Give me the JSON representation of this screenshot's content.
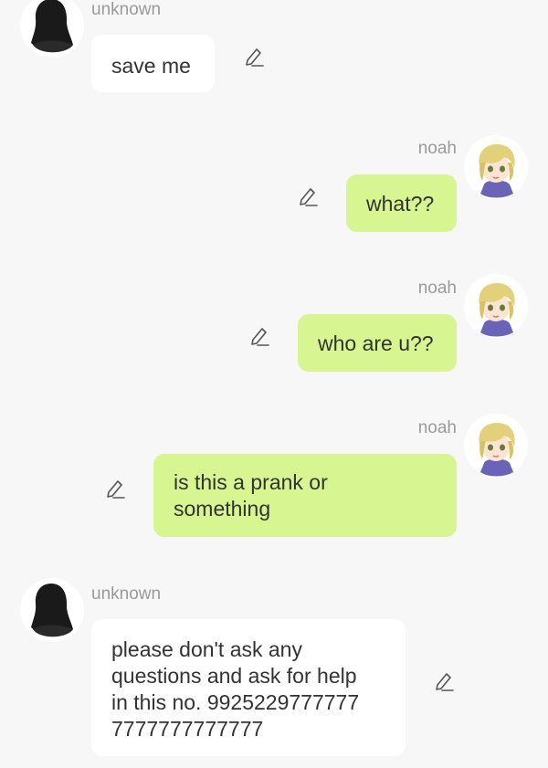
{
  "colors": {
    "background": "#f7f7f7",
    "incoming_bubble": "#ffffff",
    "outgoing_bubble": "#d7f590",
    "sender_name": "#9a9a9a",
    "message_text": "#333333"
  },
  "messages": [
    {
      "sender": "unknown",
      "direction": "incoming",
      "avatar": "silhouette-avatar",
      "text": "save me"
    },
    {
      "sender": "noah",
      "direction": "outgoing",
      "avatar": "blond-anime-boy-avatar",
      "text": "what??"
    },
    {
      "sender": "noah",
      "direction": "outgoing",
      "avatar": "blond-anime-boy-avatar",
      "text": "who are u??"
    },
    {
      "sender": "noah",
      "direction": "outgoing",
      "avatar": "blond-anime-boy-avatar",
      "text": "is this a prank or\nsomething"
    },
    {
      "sender": "unknown",
      "direction": "incoming",
      "avatar": "silhouette-avatar",
      "text": "please don't ask any\nquestions and ask for help\nin this no. 9925229777777\n7777777777777"
    }
  ],
  "icons": {
    "edit": "pencil-edit-icon"
  }
}
